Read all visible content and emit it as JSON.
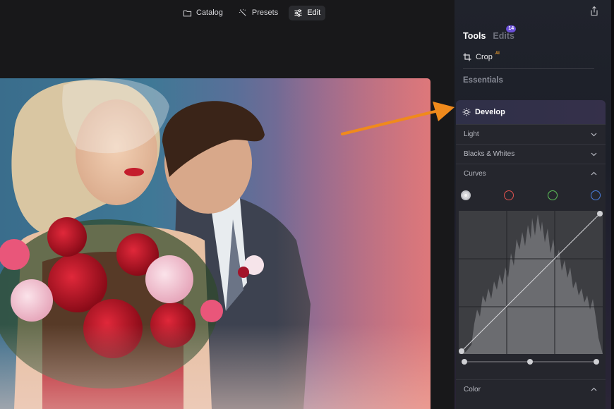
{
  "topnav": {
    "items": [
      {
        "label": "Catalog",
        "icon": "folder-icon"
      },
      {
        "label": "Presets",
        "icon": "sparkle-icon"
      },
      {
        "label": "Edit",
        "icon": "sliders-icon",
        "active": true
      }
    ]
  },
  "panel": {
    "tabs": [
      {
        "label": "Tools",
        "active": true
      },
      {
        "label": "Edits",
        "active": false,
        "badge": "14"
      }
    ],
    "crop": {
      "label": "Crop",
      "ai_badge": "AI"
    },
    "essentials_label": "Essentials",
    "develop": {
      "label": "Develop",
      "sections": [
        {
          "label": "Light",
          "expanded": false
        },
        {
          "label": "Blacks & Whites",
          "expanded": false
        },
        {
          "label": "Curves",
          "expanded": true
        }
      ],
      "curve_channels": [
        "luminance",
        "red",
        "green",
        "blue"
      ],
      "selected_channel": "luminance",
      "color_section": {
        "label": "Color",
        "expanded": true
      }
    }
  },
  "colors": {
    "accent_badge": "#6a4fd8",
    "ai_badge": "#f0a030",
    "arrow": "#f08a1c",
    "channel_red": "#e0524e",
    "channel_green": "#5ec45a",
    "channel_blue": "#4a7fe0"
  }
}
